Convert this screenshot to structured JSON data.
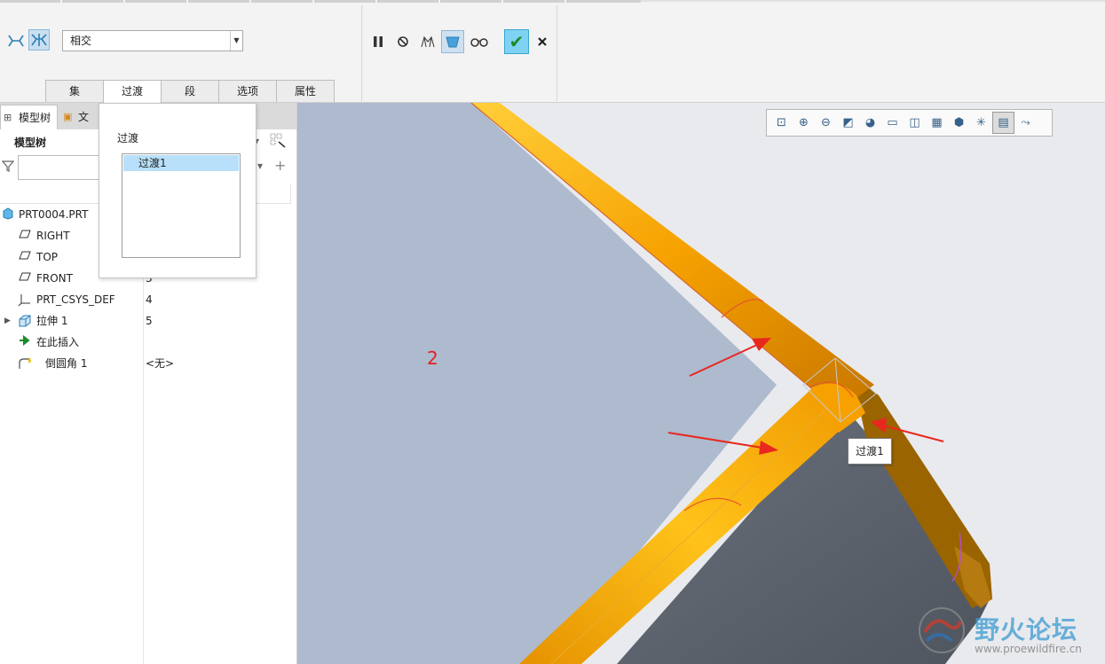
{
  "ribbon": {
    "dropdown_value": "相交",
    "tabs": [
      {
        "label": "集"
      },
      {
        "label": "过渡"
      },
      {
        "label": "段"
      },
      {
        "label": "选项"
      },
      {
        "label": "属性"
      }
    ],
    "actions": [
      "pause-icon",
      "stop-icon",
      "preview-icon",
      "verify-icon",
      "glasses-icon",
      "ok-check-icon",
      "cancel-x-icon"
    ]
  },
  "left_panel": {
    "tabs": [
      {
        "label": "模型树"
      },
      {
        "label": "文"
      }
    ],
    "title": "模型树",
    "tree": [
      {
        "label": "PRT0004.PRT",
        "num": ""
      },
      {
        "label": "RIGHT",
        "num": ""
      },
      {
        "label": "TOP",
        "num": ""
      },
      {
        "label": "FRONT",
        "num": "3"
      },
      {
        "label": "PRT_CSYS_DEF",
        "num": "4"
      },
      {
        "label": "拉伸 1",
        "num": "5"
      },
      {
        "label": "在此插入",
        "num": ""
      },
      {
        "label": "倒圆角 1",
        "num": "<无>"
      }
    ]
  },
  "popup": {
    "title": "过渡",
    "items": [
      "过渡1"
    ]
  },
  "viewport": {
    "annotation": "2",
    "tooltip": "过渡1",
    "watermark_title": "野火论坛",
    "watermark_url": "www.proewildfire.cn",
    "colors": {
      "pipe": "#f6a100",
      "plate": "#aebace",
      "plate_dark": "#5c6370",
      "arrow": "#e8281f",
      "background": "#e9eaee"
    }
  }
}
